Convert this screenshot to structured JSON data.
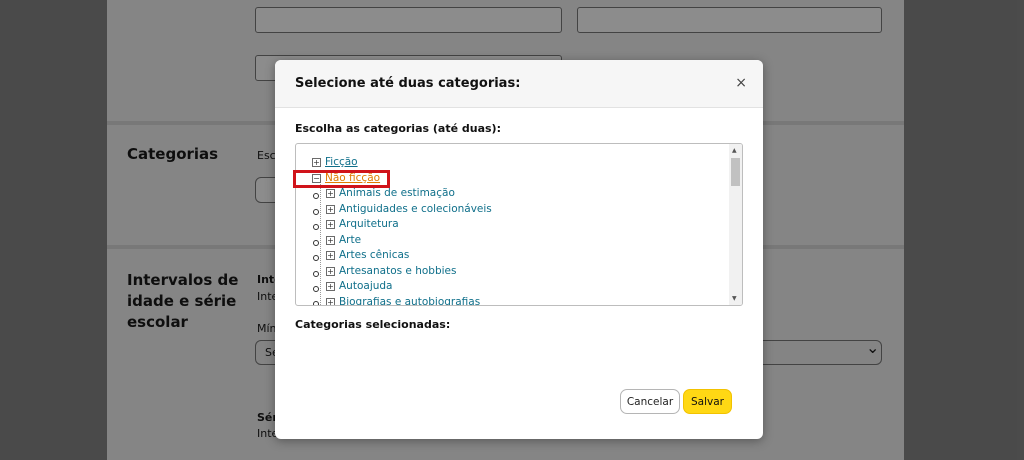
{
  "background": {
    "categories_heading": "Categorias",
    "categories_fragment": "Esco",
    "age_heading_line1": "Intervalos de",
    "age_heading_line2": "idade e série",
    "age_heading_line3": "escolar",
    "frag_inte1": "Inte",
    "frag_inte2": "Inte",
    "frag_min": "Mín",
    "frag_se": "Se",
    "frag_seri": "Séri",
    "frag_inte3": "Inte",
    "chevron": "⌄"
  },
  "modal": {
    "title": "Selecione até duas categorias:",
    "close_glyph": "×",
    "tree_label": "Escolha as categorias (até duas):",
    "tree": {
      "root1": {
        "expander": "+",
        "label": "Ficção"
      },
      "root2": {
        "expander": "−",
        "label": "Não ficção"
      },
      "children": [
        {
          "expander": "+",
          "label": "Animais de estimação"
        },
        {
          "expander": "+",
          "label": "Antiguidades e colecionáveis"
        },
        {
          "expander": "+",
          "label": "Arquitetura"
        },
        {
          "expander": "+",
          "label": "Arte"
        },
        {
          "expander": "+",
          "label": "Artes cênicas"
        },
        {
          "expander": "+",
          "label": "Artesanatos e hobbies"
        },
        {
          "expander": "+",
          "label": "Autoajuda"
        },
        {
          "expander": "+",
          "label": "Biografias e autobiografias"
        }
      ]
    },
    "selected_label": "Categorias selecionadas:",
    "cancel_label": "Cancelar",
    "save_label": "Salvar",
    "scroll_up": "▲",
    "scroll_down": "▼"
  },
  "colors": {
    "link": "#0f6f8a",
    "selected_link": "#e07b00",
    "highlight_box": "#d0131a",
    "save_button": "#ffd814"
  }
}
